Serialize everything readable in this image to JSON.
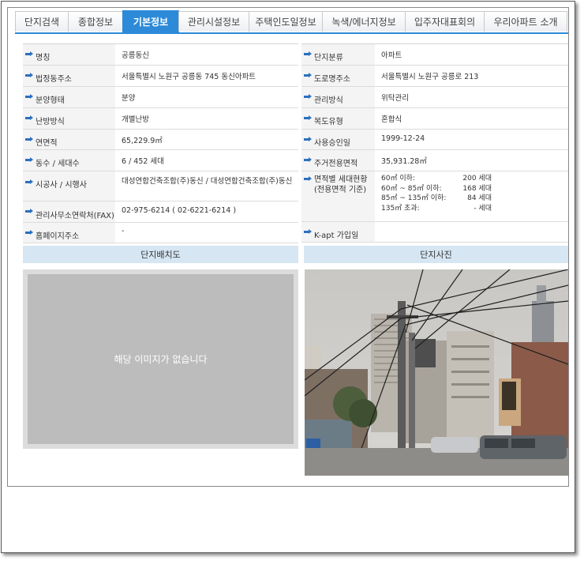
{
  "tabs": [
    {
      "label": "단지검색"
    },
    {
      "label": "종합정보"
    },
    {
      "label": "기본정보"
    },
    {
      "label": "관리시설정보"
    },
    {
      "label": "주택인도일정보"
    },
    {
      "label": "녹색/에너지정보"
    },
    {
      "label": "입주자대표회의"
    },
    {
      "label": "우리아파트 소개"
    }
  ],
  "active_tab": "기본정보",
  "left_info": [
    {
      "label": "명칭",
      "value": "공릉동신"
    },
    {
      "label": "법정동주소",
      "value": "서울특별시 노원구 공릉동 745 동신아파트"
    },
    {
      "label": "분양형태",
      "value": "분양"
    },
    {
      "label": "난방방식",
      "value": "개별난방"
    },
    {
      "label": "연면적",
      "value": "65,229.9㎡"
    },
    {
      "label": "동수 / 세대수",
      "value": "6 / 452 세대"
    },
    {
      "label": "시공사 / 시행사",
      "value": "대성연합건축조합(주)동신 / 대성연합건축조합(주)동신"
    },
    {
      "label": "관리사무소연락처(FAX)",
      "value": "02-975-6214 ( 02-6221-6214 )"
    },
    {
      "label": "홈페이지주소",
      "value": "-"
    }
  ],
  "right_info": [
    {
      "label": "단지분류",
      "value": "아파트"
    },
    {
      "label": "도로명주소",
      "value": "서울특별시 노원구 공릉로 213"
    },
    {
      "label": "관리방식",
      "value": "위탁관리"
    },
    {
      "label": "복도유형",
      "value": "혼합식"
    },
    {
      "label": "사용승인일",
      "value": "1999-12-24"
    },
    {
      "label": "주거전용면적",
      "value": "35,931.28㎡"
    },
    {
      "label": "K-apt 가입일",
      "value": ""
    }
  ],
  "area_breakdown": {
    "label_line1": "면적별 세대현황",
    "label_line2": "(전용면적 기준)",
    "rows": [
      {
        "range": "60㎡ 이하:",
        "count": "200 세대"
      },
      {
        "range": "60㎡ ~ 85㎡ 이하:",
        "count": "168 세대"
      },
      {
        "range": "85㎡ ~ 135㎡ 이하:",
        "count": "84 세대"
      },
      {
        "range": "135㎡ 초과:",
        "count": "- 세대"
      }
    ]
  },
  "panels": {
    "layout_title": "단지배치도",
    "photo_title": "단지사진",
    "no_image_text": "해당 이미지가 없습니다"
  }
}
